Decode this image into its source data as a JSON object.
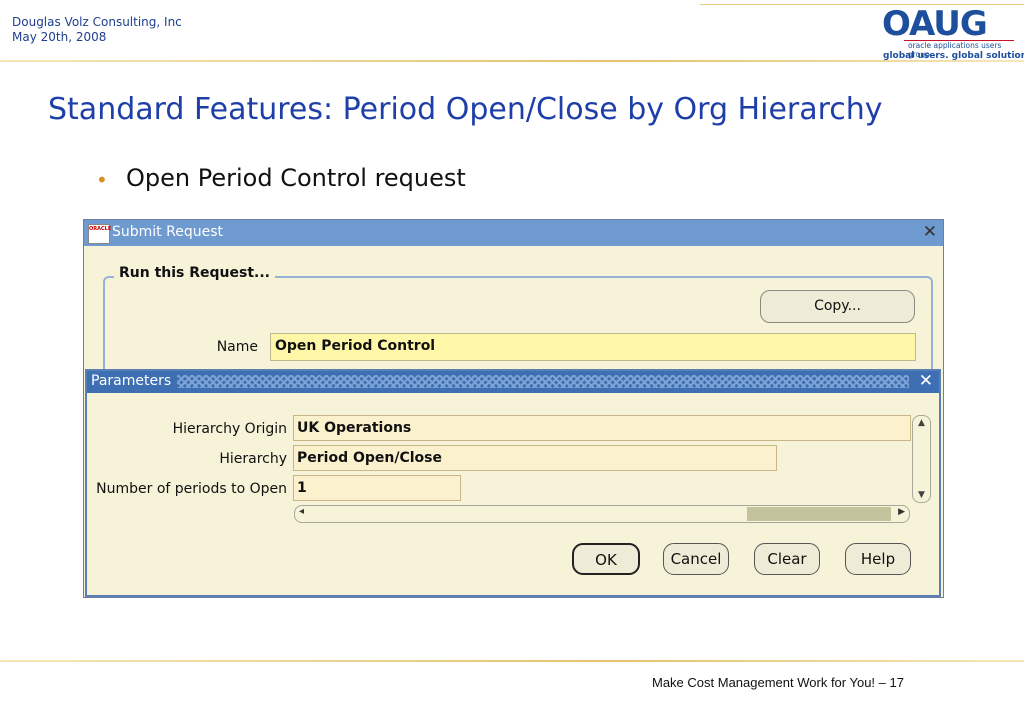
{
  "header": {
    "company": "Douglas Volz Consulting, Inc",
    "date": "May 20th, 2008",
    "logo_text": "OAUG",
    "logo_subtitle": "oracle applications users group",
    "logo_tagline": "global users. global solutions."
  },
  "slide": {
    "title": "Standard Features:  Period Open/Close by Org Hierarchy",
    "bullet": "Open Period Control request"
  },
  "submit_window": {
    "title": "Submit Request",
    "icon_text": "ORACLE",
    "group_label": "Run this Request...",
    "copy_button": "Copy...",
    "name_label": "Name",
    "name_value": "Open Period Control"
  },
  "parameters_window": {
    "title": "Parameters",
    "fields": [
      {
        "label": "Hierarchy Origin",
        "value": "UK Operations"
      },
      {
        "label": "Hierarchy",
        "value": "Period Open/Close"
      },
      {
        "label": "Number of periods to Open",
        "value": "1"
      }
    ],
    "buttons": {
      "ok": "OK",
      "cancel": "Cancel",
      "clear": "Clear",
      "help": "Help"
    }
  },
  "footer": {
    "text": "Make Cost Management Work for You! – 17"
  },
  "colors": {
    "title_blue": "#1f3fa8",
    "bullet_orange": "#d9922a",
    "field_yellow": "#fff7a8",
    "window_bg": "#f6f3d8",
    "param_title": "#3e6fb3"
  }
}
